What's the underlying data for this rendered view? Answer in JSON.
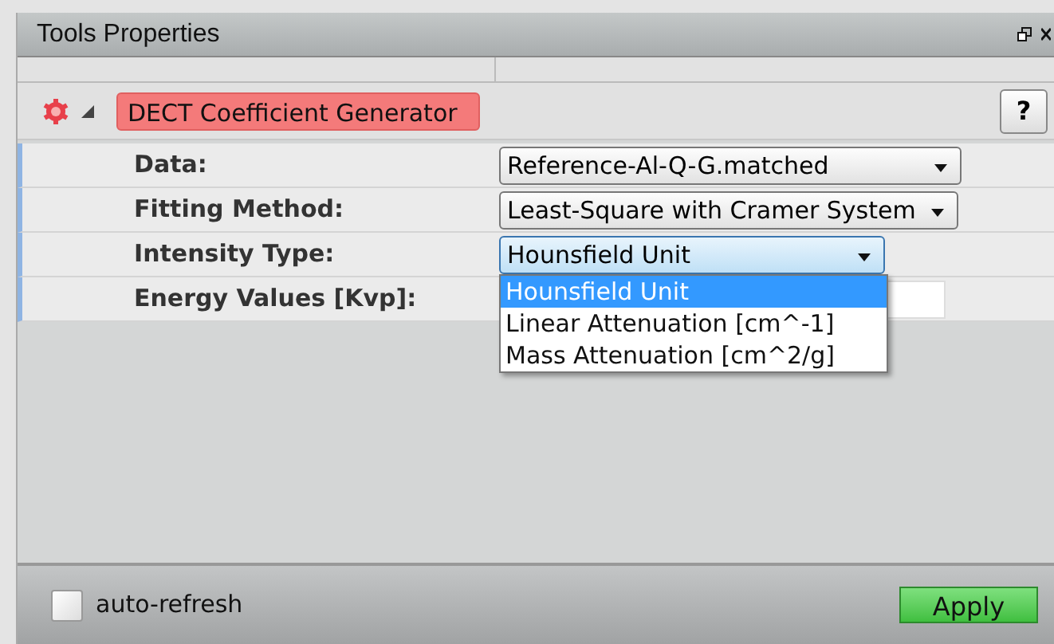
{
  "window": {
    "title": "Tools Properties"
  },
  "tool": {
    "name": "DECT Coefficient Generator",
    "expanded": true,
    "help": "?"
  },
  "properties": [
    {
      "kind": "select",
      "label": "Data:",
      "value": "Reference-Al-Q-G.matched",
      "open": false
    },
    {
      "kind": "select",
      "label": "Fitting Method:",
      "value": "Least-Square with Cramer System",
      "open": false
    },
    {
      "kind": "select",
      "label": "Intensity Type:",
      "value": "Hounsfield Unit",
      "open": true,
      "options": [
        {
          "label": "Hounsfield Unit",
          "selected": true
        },
        {
          "label": "Linear Attenuation [cm^-1]",
          "selected": false
        },
        {
          "label": "Mass Attenuation [cm^2/g]",
          "selected": false
        }
      ]
    },
    {
      "kind": "input",
      "label": "Energy Values [Kvp]:"
    }
  ],
  "footer": {
    "auto_refresh": {
      "label": "auto-refresh",
      "checked": false
    },
    "apply": "Apply"
  }
}
